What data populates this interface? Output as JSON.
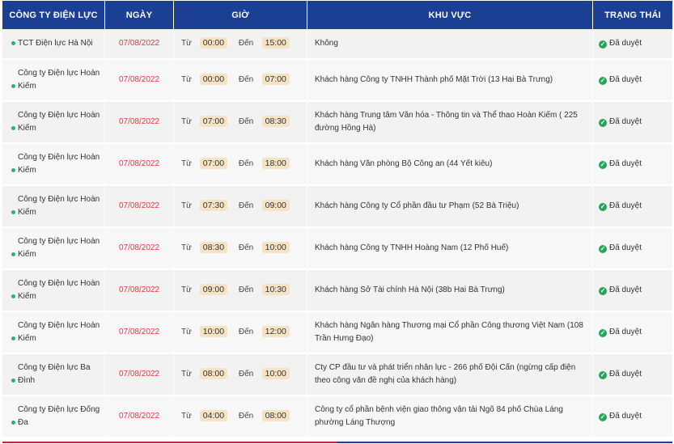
{
  "header": {
    "company": "CÔNG TY ĐIỆN LỰC",
    "date": "NGÀY",
    "time": "GIỜ",
    "area": "KHU VỰC",
    "status": "TRẠNG THÁI"
  },
  "labels": {
    "from": "Từ",
    "to": "Đến"
  },
  "rows": [
    {
      "company": "TCT Điện lực Hà Nội",
      "date": "07/08/2022",
      "start": "00:00",
      "end": "15:00",
      "area": "Không",
      "status": "Đã duyệt"
    },
    {
      "company": "Công ty Điện lực Hoàn Kiếm",
      "date": "07/08/2022",
      "start": "00:00",
      "end": "07:00",
      "area": "Khách hàng Công ty TNHH Thành phố Mặt Trời (13 Hai Bà Trưng)",
      "status": "Đã duyệt"
    },
    {
      "company": "Công ty Điện lực Hoàn Kiếm",
      "date": "07/08/2022",
      "start": "07:00",
      "end": "08:30",
      "area": "Khách hàng Trung tâm Văn hóa - Thông tin và Thể thao Hoàn Kiếm ( 225 đường Hồng Hà)",
      "status": "Đã duyệt"
    },
    {
      "company": "Công ty Điện lực Hoàn Kiếm",
      "date": "07/08/2022",
      "start": "07:00",
      "end": "18:00",
      "area": "Khách hàng Văn phòng Bộ Công an (44 Yết kiêu)",
      "status": "Đã duyệt"
    },
    {
      "company": "Công ty Điện lực Hoàn Kiếm",
      "date": "07/08/2022",
      "start": "07:30",
      "end": "09:00",
      "area": "Khách hàng Công ty Cổ phần đầu tư Phạm (52 Bà Triệu)",
      "status": "Đã duyệt"
    },
    {
      "company": "Công ty Điện lực Hoàn Kiếm",
      "date": "07/08/2022",
      "start": "08:30",
      "end": "10:00",
      "area": "Khách hàng Công ty TNHH Hoàng Nam (12 Phố Huế)",
      "status": "Đã duyệt"
    },
    {
      "company": "Công ty Điện lực Hoàn Kiếm",
      "date": "07/08/2022",
      "start": "09:00",
      "end": "10:30",
      "area": "Khách hàng Sở Tài chính Hà Nội (38b Hai Bà Trưng)",
      "status": "Đã duyệt"
    },
    {
      "company": "Công ty Điện lực Hoàn Kiếm",
      "date": "07/08/2022",
      "start": "10:00",
      "end": "12:00",
      "area": "Khách hàng Ngân hàng Thương mại Cổ phần Công thương Việt Nam (108 Trần Hưng Đạo)",
      "status": "Đã duyệt"
    },
    {
      "company": "Công ty Điện lực Ba Đình",
      "date": "07/08/2022",
      "start": "08:00",
      "end": "10:00",
      "area": "Cty CP đầu tư và phát triển nhân lực - 266 phố Đội Cấn (ngừng cấp điện theo công văn đề nghị của khách hàng)",
      "status": "Đã duyệt"
    },
    {
      "company": "Công ty Điện lực Đống Đa",
      "date": "07/08/2022",
      "start": "04:00",
      "end": "08:00",
      "area": "Công ty cổ phần bệnh viện giao thông vận tải Ngõ 84 phố Chùa Láng phường Láng Thượng",
      "status": "Đã duyệt"
    }
  ],
  "colors": {
    "header_bg": "#1b3f93",
    "date_text": "#e03c3c",
    "dot": "#2db070",
    "pill_bg": "#f5e3c4",
    "check": "#27a45c"
  },
  "icons": {
    "status": "check-circle-icon",
    "bullet": "bullet-dot-icon"
  }
}
